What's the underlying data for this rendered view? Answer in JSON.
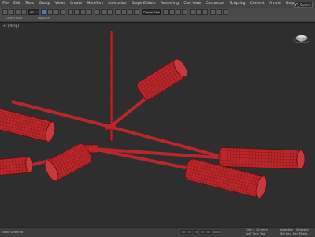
{
  "menu": {
    "items": [
      "File",
      "Edit",
      "Tools",
      "Group",
      "Views",
      "Create",
      "Modifiers",
      "Animation",
      "Graph Editors",
      "Rendering",
      "Civil View",
      "Customize",
      "Scripting",
      "Content",
      "Arnold",
      "Help"
    ],
    "search_label": "Search"
  },
  "toolbar": {
    "selection_filter": "All",
    "named_set": "Create Selection Set",
    "sublabels": [
      "Object Paint",
      "Populate"
    ]
  },
  "viewport": {
    "label": "[+] [Persp]",
    "model_color": "#b9272a",
    "wire_color": "#6a0d10"
  },
  "status": {
    "selection": "None Selected",
    "grid": "Grid = 10,0mm",
    "time_tag": "Add Time Tag",
    "auto_key": "Auto Key",
    "selected": "Selected",
    "set_key": "Set Key",
    "filters": "Key Filters...",
    "frame": "0"
  }
}
